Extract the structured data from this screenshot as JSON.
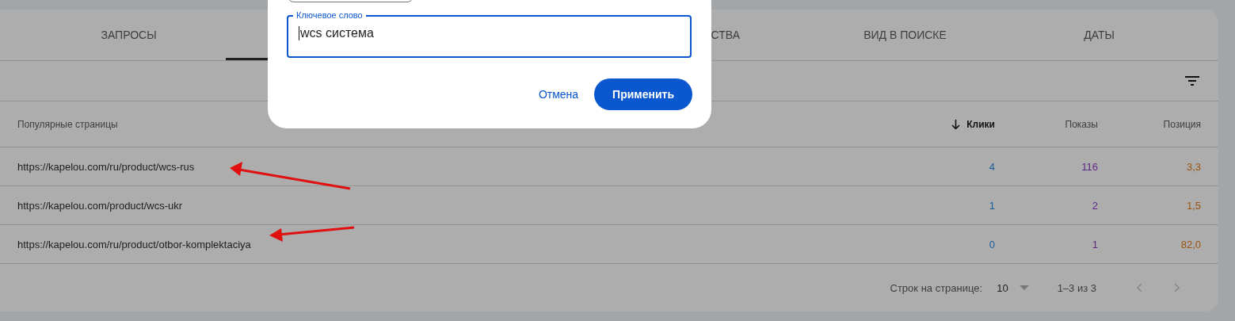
{
  "tabs": [
    {
      "label": "ЗАПРОСЫ",
      "selected": false
    },
    {
      "selected": true
    },
    {
      "label": "СТВА",
      "selected": false,
      "cut_left": true
    },
    {
      "label": "ВИД В ПОИСКЕ",
      "selected": false
    },
    {
      "label": "ДАТЫ",
      "selected": false
    }
  ],
  "table": {
    "columns": [
      {
        "label": "Популярные страницы",
        "sorted": false
      },
      {
        "label": "Клики",
        "sorted": true
      },
      {
        "label": "Показы",
        "sorted": false
      },
      {
        "label": "Позиция",
        "sorted": false
      }
    ],
    "rows": [
      [
        "https://kapelou.com/ru/product/wcs-rus",
        "4",
        "116",
        "3,3"
      ],
      [
        "https://kapelou.com/product/wcs-ukr",
        "1",
        "2",
        "1,5"
      ],
      [
        "https://kapelou.com/ru/product/otbor-komplektaciya",
        "0",
        "1",
        "82,0"
      ]
    ]
  },
  "pagination": {
    "rows_label": "Строк на странице:",
    "rows_value": "10",
    "range": "1–3 из 3"
  },
  "dialog": {
    "field": {
      "label": "Ключевое слово",
      "value": "wcs система"
    },
    "buttons": [
      {
        "label": "Отмена",
        "kind": "text"
      },
      {
        "label": "Применить",
        "kind": "filled"
      }
    ]
  }
}
